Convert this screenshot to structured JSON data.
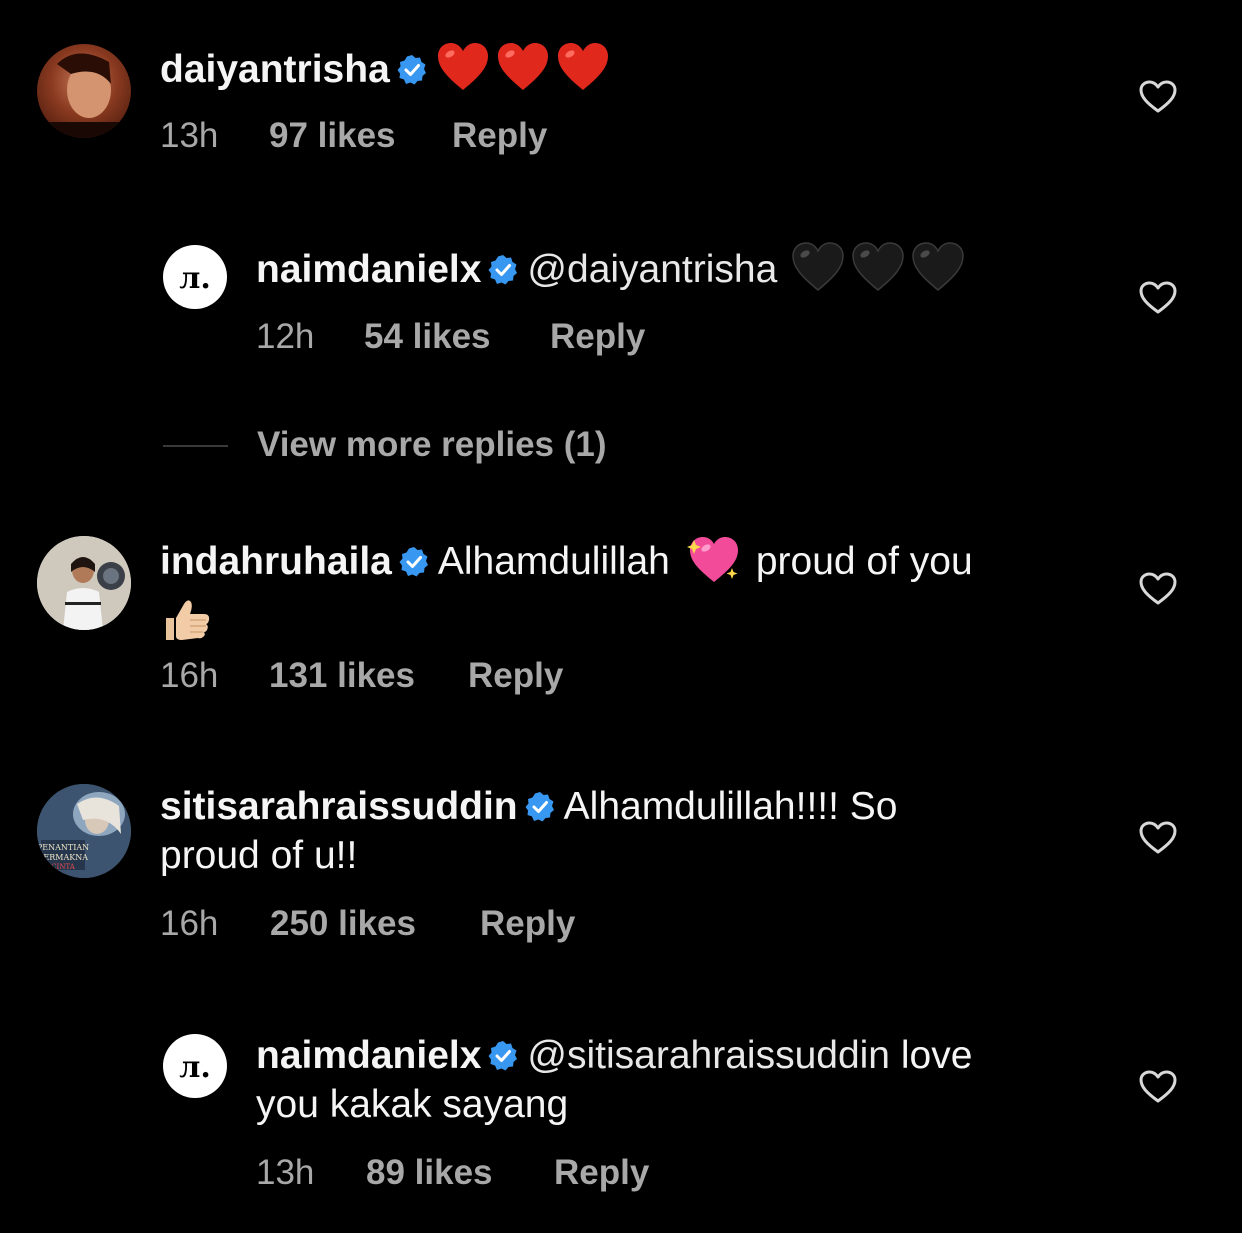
{
  "comments": [
    {
      "username": "daiyantrisha",
      "text": "",
      "emojis": [
        "heart",
        "heart",
        "heart"
      ],
      "time": "13h",
      "likes": "97 likes",
      "reply": "Reply"
    },
    {
      "username": "naimdanielx",
      "mention": "@daiyantrisha",
      "text": "",
      "emojis": [
        "black-heart",
        "black-heart",
        "black-heart"
      ],
      "time": "12h",
      "likes": "54 likes",
      "reply": "Reply",
      "avatar_logo": "л."
    },
    {
      "username": "indahruhaila",
      "text": "Alhamdulillah",
      "text_after_emoji": "proud of you",
      "time": "16h",
      "likes": "131 likes",
      "reply": "Reply"
    },
    {
      "username": "sitisarahraissuddin",
      "text_line1": "Alhamdulillah!!!! So",
      "text_line2": "proud of u!!",
      "time": "16h",
      "likes": "250 likes",
      "reply": "Reply",
      "avatar_text": "PENANTIAN PERMAKNA"
    },
    {
      "username": "naimdanielx",
      "mention": "@sitisarahraissuddin",
      "text_line1_suffix": "love",
      "text_line2": "you kakak sayang",
      "time": "13h",
      "likes": "89 likes",
      "reply": "Reply",
      "avatar_logo": "л."
    }
  ],
  "view_more_replies": "View more replies (1)",
  "colors": {
    "background": "#000000",
    "text": "#f5f5f5",
    "meta": "#a8a8a8",
    "verified": "#3897f0",
    "red_heart": "#e0281d"
  },
  "icons": [
    "verified-badge-icon",
    "like-heart-icon",
    "red-heart-emoji",
    "black-heart-emoji",
    "sparkling-heart-emoji",
    "thumbs-up-emoji"
  ]
}
